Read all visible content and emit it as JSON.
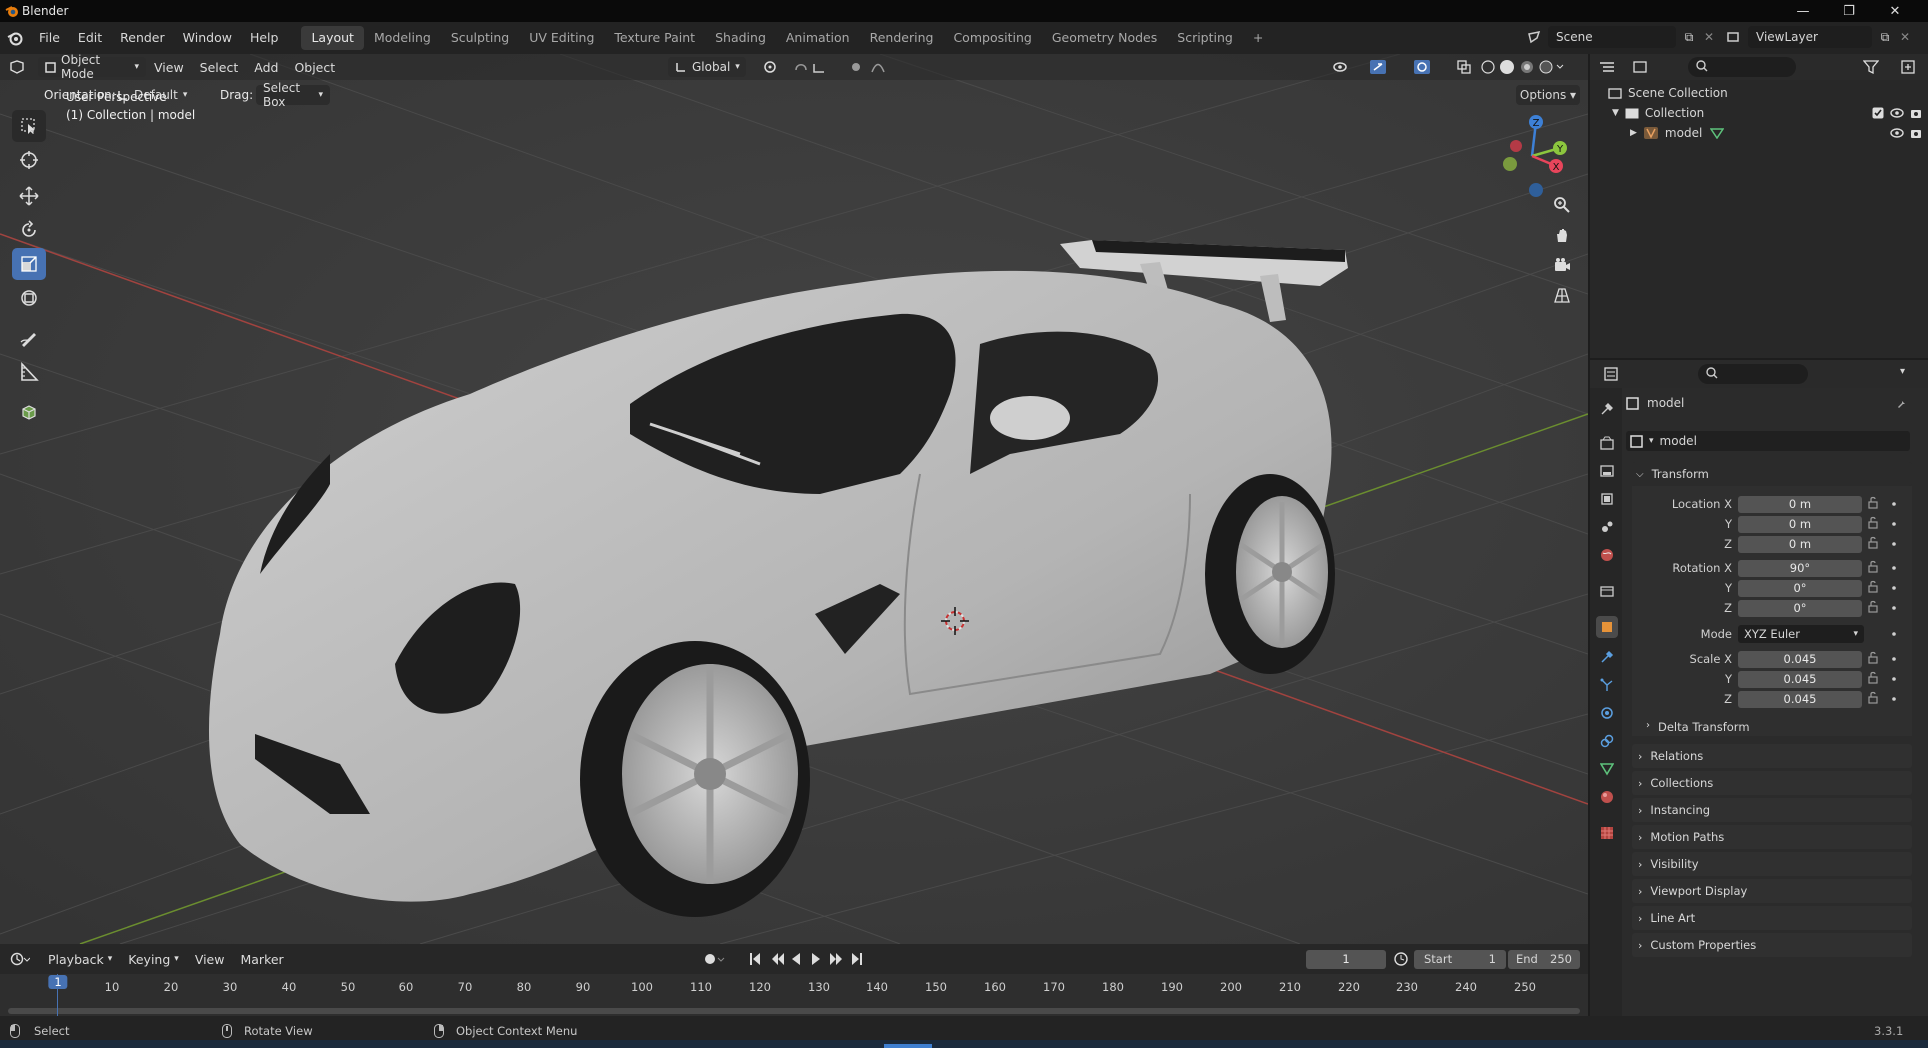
{
  "window": {
    "title": "Blender"
  },
  "menu": [
    "File",
    "Edit",
    "Render",
    "Window",
    "Help"
  ],
  "workspaces": [
    "Layout",
    "Modeling",
    "Sculpting",
    "UV Editing",
    "Texture Paint",
    "Shading",
    "Animation",
    "Rendering",
    "Compositing",
    "Geometry Nodes",
    "Scripting"
  ],
  "active_workspace": "Layout",
  "scene": {
    "name": "Scene",
    "view_layer": "ViewLayer"
  },
  "viewport_header": {
    "mode": "Object Mode",
    "menus": [
      "View",
      "Select",
      "Add",
      "Object"
    ],
    "orientation_global": "Global",
    "orientation_label": "Orientation:",
    "orientation_value": "Default",
    "drag_label": "Drag:",
    "drag_value": "Select Box",
    "options": "Options"
  },
  "overlay_text": {
    "perspective": "User Perspective",
    "collection": "(1) Collection | model"
  },
  "gizmo": {
    "x": "X",
    "y": "Y",
    "z": "Z"
  },
  "outliner": {
    "root": "Scene Collection",
    "collection": "Collection",
    "object": "model"
  },
  "properties": {
    "object_name": "model",
    "data_name": "model",
    "transform_title": "Transform",
    "location_label": "Location X",
    "rotation_label": "Rotation X",
    "scale_label": "Scale X",
    "y": "Y",
    "z": "Z",
    "location": [
      "0 m",
      "0 m",
      "0 m"
    ],
    "rotation": [
      "90°",
      "0°",
      "0°"
    ],
    "mode_label": "Mode",
    "mode": "XYZ Euler",
    "scale": [
      "0.045",
      "0.045",
      "0.045"
    ],
    "delta": "Delta Transform",
    "panels": [
      "Relations",
      "Collections",
      "Instancing",
      "Motion Paths",
      "Visibility",
      "Viewport Display",
      "Line Art",
      "Custom Properties"
    ]
  },
  "timeline": {
    "menus": [
      "Playback",
      "Keying",
      "View",
      "Marker"
    ],
    "current_frame": "1",
    "start_label": "Start",
    "start": "1",
    "end_label": "End",
    "end": "250",
    "ticks": [
      "1",
      "10",
      "20",
      "30",
      "40",
      "50",
      "60",
      "70",
      "80",
      "90",
      "100",
      "110",
      "120",
      "130",
      "140",
      "150",
      "160",
      "170",
      "180",
      "190",
      "200",
      "210",
      "220",
      "230",
      "240",
      "250"
    ]
  },
  "status": {
    "select": "Select",
    "rotate": "Rotate View",
    "context": "Object Context Menu",
    "version": "3.3.1"
  },
  "colors": {
    "accent": "#4772b3",
    "x_axis": "#e8455b",
    "y_axis": "#8cc63e",
    "z_axis": "#3d80d6"
  }
}
